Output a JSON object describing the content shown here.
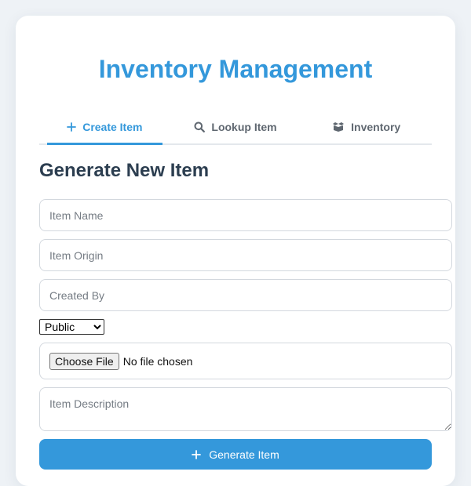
{
  "app": {
    "title": "Inventory Management"
  },
  "tabs": [
    {
      "label": "Create Item",
      "icon": "plus-icon",
      "active": true
    },
    {
      "label": "Lookup Item",
      "icon": "search-icon",
      "active": false
    },
    {
      "label": "Inventory",
      "icon": "boxes-icon",
      "active": false
    }
  ],
  "form": {
    "section_title": "Generate New Item",
    "item_name_placeholder": "Item Name",
    "item_origin_placeholder": "Item Origin",
    "created_by_placeholder": "Created By",
    "visibility_selected": "Public",
    "file_button_label": "Choose File",
    "file_status": "No file chosen",
    "description_placeholder": "Item Description",
    "submit_label": "Generate Item"
  },
  "colors": {
    "accent": "#3498db",
    "heading": "#2c3e50",
    "page_background": "#eef2f6"
  }
}
